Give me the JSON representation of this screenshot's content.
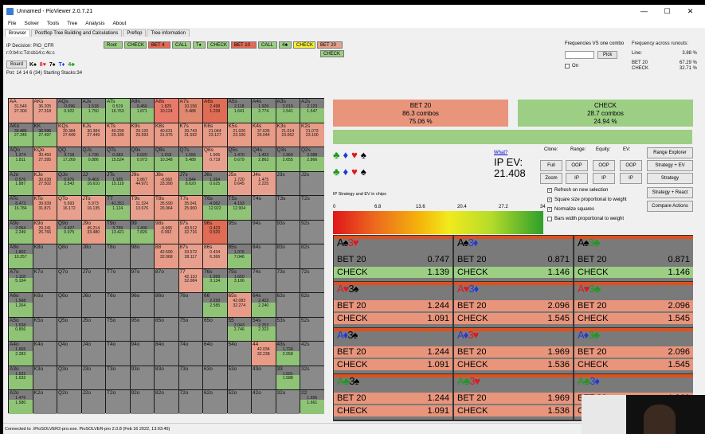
{
  "window": {
    "title": "Unnamed - PioViewer 2.0.7.21",
    "min": "—",
    "max": "☐",
    "close": "✕"
  },
  "menu": [
    "File",
    "Solver",
    "Tools",
    "Tree",
    "Analysis",
    "About"
  ],
  "tabs": [
    "Browser",
    "Postflop Tree Building and Calculations",
    "Preflop",
    "Tree information"
  ],
  "info": {
    "decision": "IP Decision:  PIO_CFR",
    "board_str": "r:0:b4:c:Td:cb14:c:4c:c",
    "board_btn": "Board",
    "pot": "Pot: 14 14 6 (34) Starting Stacks:34"
  },
  "board_cards": [
    {
      "r": "K",
      "s": "♠",
      "c": "sp"
    },
    {
      "r": "8",
      "s": "♥",
      "c": "ht"
    },
    {
      "r": "7",
      "s": "♠",
      "c": "sp"
    },
    {
      "r": "T",
      "s": "♦",
      "c": "dm"
    },
    {
      "r": "4",
      "s": "♣",
      "c": "cl"
    }
  ],
  "tree": [
    {
      "label": "Root",
      "bg": "#9ccf84",
      "row": 0
    },
    {
      "label": "CHECK",
      "bg": "#9ccf84",
      "row": 0
    },
    {
      "label": "BET 4",
      "bg": "#e26a55",
      "row": 0
    },
    {
      "label": "CALL",
      "bg": "#9ccf84",
      "row": 0
    },
    {
      "label": "T♦",
      "bg": "#9ccf84",
      "row": 0
    },
    {
      "label": "CHECK",
      "bg": "#9ccf84",
      "row": 0
    },
    {
      "label": "BET 10",
      "bg": "#e26a55",
      "row": 0
    },
    {
      "label": "CALL",
      "bg": "#9ccf84",
      "row": 0
    },
    {
      "label": "4♣",
      "bg": "#9ccf84",
      "row": 0
    },
    {
      "label": "CHECK",
      "bg": "#f7f03a",
      "row": 0
    },
    {
      "label": "BET 20",
      "bg": "#e6a08b",
      "row": 0
    },
    {
      "label": "CHECK",
      "bg": "#9ccf84",
      "row": 1
    }
  ],
  "freq": {
    "title": "Frequencies VS one combo",
    "pick": "Pick",
    "on": "On"
  },
  "runouts": {
    "title": "Frequency across runouts:",
    "line_label": "Line:",
    "line_val": "3.88 %",
    "rows": [
      {
        "k": "BET 20",
        "v": "67.29 %"
      },
      {
        "k": "CHECK",
        "v": "32.71 %"
      }
    ]
  },
  "matrix": {
    "names": [
      [
        "AA",
        "AKs",
        "AQs",
        "AJs",
        "ATs",
        "A9s",
        "A8s",
        "A7s",
        "A6s",
        "A5s",
        "A4s",
        "A3s",
        "A2s"
      ],
      [
        "AKo",
        "KK",
        "KQs",
        "KJs",
        "KTs",
        "K9s",
        "K8s",
        "K7s",
        "K6s",
        "K5s",
        "K4s",
        "K3s",
        "K2s"
      ],
      [
        "AQo",
        "KQo",
        "QQ",
        "QJs",
        "QTs",
        "Q9s",
        "Q8s",
        "Q7s",
        "Q6s",
        "Q5s",
        "Q4s",
        "Q3s",
        "Q2s"
      ],
      [
        "AJo",
        "KJo",
        "QJo",
        "JJ",
        "JTs",
        "J9s",
        "J8s",
        "J7s",
        "J6s",
        "J5s",
        "J4s",
        "J3s",
        "J2s"
      ],
      [
        "ATo",
        "KTo",
        "QTo",
        "JTo",
        "TT",
        "T9s",
        "T8s",
        "T7s",
        "T6s",
        "T5s",
        "T4s",
        "T3s",
        "T2s"
      ],
      [
        "A9o",
        "K9o",
        "Q9o",
        "J9o",
        "T9o",
        "99",
        "98s",
        "97s",
        "96s",
        "95s",
        "94s",
        "93s",
        "92s"
      ],
      [
        "A8o",
        "K8o",
        "Q8o",
        "J8o",
        "T8o",
        "98o",
        "88",
        "87s",
        "86s",
        "85s",
        "84s",
        "83s",
        "82s"
      ],
      [
        "A7o",
        "K7o",
        "Q7o",
        "J7o",
        "T7o",
        "97o",
        "87o",
        "77",
        "76s",
        "75s",
        "74s",
        "73s",
        "72s"
      ],
      [
        "A6o",
        "K6o",
        "Q6o",
        "J6o",
        "T6o",
        "96o",
        "86o",
        "76o",
        "66",
        "65s",
        "64s",
        "63s",
        "62s"
      ],
      [
        "A5o",
        "K5o",
        "Q5o",
        "J5o",
        "T5o",
        "95o",
        "85o",
        "75o",
        "65o",
        "55",
        "54s",
        "53s",
        "52s"
      ],
      [
        "A4o",
        "K4o",
        "Q4o",
        "J4o",
        "T4o",
        "94o",
        "84o",
        "74o",
        "64o",
        "54o",
        "44",
        "43s",
        "42s"
      ],
      [
        "A3o",
        "K3o",
        "Q3o",
        "J3o",
        "T3o",
        "93o",
        "83o",
        "73o",
        "63o",
        "53o",
        "43o",
        "33",
        "32s"
      ],
      [
        "A2o",
        "K2o",
        "Q2o",
        "J2o",
        "T2o",
        "92o",
        "82o",
        "72o",
        "62o",
        "52o",
        "42o",
        "32o",
        "22"
      ]
    ],
    "vals": {
      "0,0": [
        "31.549",
        "27.300"
      ],
      "0,1": [
        "36.205",
        "27.318"
      ],
      "0,2": [
        "-0.096",
        "0.922"
      ],
      "0,3": [
        "1.518",
        "1.750"
      ],
      "0,4": [
        "0.519",
        "16.763"
      ],
      "0,5": [
        "0.456",
        "1.871"
      ],
      "0,6": [
        "1.825",
        "10.124"
      ],
      "0,7": [
        "10.156",
        "5.488"
      ],
      "0,8": [
        "2.498",
        "1.239"
      ],
      "0,9": [
        "2.118",
        "1.641"
      ],
      "0,10": [
        "1.926",
        "2.774"
      ],
      "0,11": [
        "2.019",
        "1.541"
      ],
      "0,12": [
        "2.123",
        "1.547"
      ],
      "1,0": [
        "30.485",
        "27.345"
      ],
      "1,1": [
        "36.596",
        "27.497"
      ],
      "1,2": [
        "30.384",
        "27.449"
      ],
      "1,3": [
        "30.384",
        "27.449"
      ],
      "1,4": [
        "40.299",
        "29.180"
      ],
      "1,5": [
        "29.120",
        "26.593"
      ],
      "1,6": [
        "40.631",
        "31.976"
      ],
      "1,7": [
        "39.743",
        "31.592"
      ],
      "1,8": [
        "21.044",
        "23.127"
      ],
      "1,9": [
        "21.026",
        "23.100"
      ],
      "1,10": [
        "37.635",
        "26.044"
      ],
      "1,11": [
        "21.014",
        "23.062"
      ],
      "1,12": [
        "21.073",
        "23.100"
      ],
      "2,0": [
        "1.374",
        "1.811"
      ],
      "2,1": [
        "30.450",
        "27.395"
      ],
      "2,2": [
        "9.718",
        "17.269"
      ],
      "2,3": [
        "1.736",
        "0.886"
      ],
      "2,4": [
        "0.283",
        "15.524"
      ],
      "2,5": [
        "0.020",
        "0.973"
      ],
      "2,6": [
        "1.918",
        "10.348"
      ],
      "2,7": [
        "1.556",
        "5.488"
      ],
      "2,8": [
        "1.606",
        "0.719"
      ],
      "2,9": [
        "1.470",
        "0.679"
      ],
      "2,10": [
        "1.422",
        "2.863"
      ],
      "2,11": [
        "1.969",
        "2.655"
      ],
      "2,12": [
        "2.088",
        "2.866"
      ],
      "3,0": [
        "0.576",
        "1.887"
      ],
      "3,1": [
        "30.639",
        "27.502"
      ],
      "3,2": [
        "0.676",
        "2.543"
      ],
      "3,3": [
        "9.463",
        "16.610"
      ],
      "3,4": [
        "1.165",
        "15.119"
      ],
      "3,5": [
        "5.867",
        "44.971"
      ],
      "3,6": [
        "-0.060",
        "33.390"
      ],
      "3,7": [
        "1.844",
        "8.620"
      ],
      "3,8": [
        "1.264",
        "0.625"
      ],
      "3,9": [
        "1.720",
        "0.645"
      ],
      "3,10": [
        "1.475",
        "2.225"
      ],
      "4,0": [
        "8.473",
        "16.784"
      ],
      "4,1": [
        "39.939",
        "31.871"
      ],
      "4,2": [
        "5.693",
        "16.172"
      ],
      "4,3": [
        "5.973",
        "16.135"
      ],
      "4,4": [
        "41.351",
        "1.124"
      ],
      "4,5": [
        "11.324",
        "13.676"
      ],
      "4,6": [
        "35.590",
        "26.964"
      ],
      "4,7": [
        "35.041",
        "25.900"
      ],
      "4,8": [
        "4.062",
        "12.922"
      ],
      "4,9": [
        "4.193",
        "12.904"
      ],
      "5,0": [
        "2.054",
        "2.249"
      ],
      "5,1": [
        "29.241",
        "26.766"
      ],
      "5,2": [
        "0.427",
        "0.975"
      ],
      "5,3": [
        "45.214",
        "33.480"
      ],
      "5,4": [
        "3.799",
        "13.421"
      ],
      "5,5": [
        "1.400",
        "7.826"
      ],
      "5,6": [
        "-0.665",
        "0.092"
      ],
      "5,7": [
        "43.512",
        "32.716"
      ],
      "5,8": [
        "0.423",
        "0.520"
      ],
      "6,0": [
        "1.802",
        "10.257"
      ],
      "6,6": [
        "42.590",
        "32.068"
      ],
      "6,7": [
        "33.572",
        "28.117"
      ],
      "6,8": [
        "0.434",
        "6.366"
      ],
      "6,9": [
        "1.076",
        "7.046"
      ],
      "7,0": [
        "1.118",
        "5.104"
      ],
      "7,7": [
        "42.110",
        "32.084"
      ],
      "7,8": [
        "1.959",
        "3.134"
      ],
      "7,9": [
        "1.650",
        "3.106"
      ],
      "8,0": [
        "1.568",
        "1.264"
      ],
      "8,8": [
        "2.220",
        "2.585"
      ],
      "8,9": [
        "42.083",
        "32.274"
      ],
      "8,10": [
        "2.422",
        "2.240"
      ],
      "9,0": [
        "1.638",
        "0.856"
      ],
      "9,9": [
        "2.043",
        "2.746"
      ],
      "9,10": [
        "2.252",
        "2.323"
      ],
      "10,0": [
        "1.665",
        "2.283"
      ],
      "10,10": [
        "42.034",
        "32.238"
      ],
      "10,11": [
        "1.724",
        "2.058"
      ],
      "11,0": [
        "1.531",
        "1.632"
      ],
      "11,11": [
        "1.501",
        "1.588"
      ],
      "12,0": [
        "1.476",
        "1.580"
      ],
      "12,12": [
        "1.656",
        "1.661"
      ]
    },
    "colors": {
      "0,0": "#e8a08e",
      "0,1": "#e8a08e",
      "0,4": "#8fc477",
      "0,6": "#e87a6a",
      "0,7": "#e08870",
      "0,8": "#e06c55",
      "1,2": "#e89c88",
      "1,3": "#e8a08e",
      "1,4": "#e89c88",
      "1,5": "#e89c88",
      "1,6": "#e89c88",
      "1,7": "#e89c88",
      "1,8": "#e89c88",
      "1,9": "#e89c88",
      "1,10": "#e89c88",
      "1,11": "#e89c88",
      "1,12": "#e89c88",
      "2,1": "#e89c88",
      "2,8": "#e8a08e",
      "3,1": "#e89c88",
      "3,5": "#e89c88",
      "3,6": "#e89c88",
      "3,9": "#e8a08e",
      "3,10": "#e8a08e",
      "4,1": "#e89c88",
      "4,2": "#e8a08e",
      "4,3": "#e8a08e",
      "4,5": "#e8a08e",
      "4,6": "#e89c88",
      "4,7": "#e89c88",
      "5,1": "#e89c88",
      "5,3": "#e89c88",
      "5,6": "#e89c88",
      "5,7": "#e89c88",
      "5,8": "#e06c55",
      "6,6": "#e89c88",
      "6,7": "#e8a08e",
      "6,8": "#e8a08e",
      "7,7": "#e8a08e",
      "8,9": "#e89c88",
      "10,10": "#e89c88"
    }
  },
  "summary": [
    {
      "label": "BET 20",
      "combos": "86.3 combos",
      "pct": "75.06 %",
      "bg": "#e8957c"
    },
    {
      "label": "CHECK",
      "combos": "28.7 combos",
      "pct": "24.94 %",
      "bg": "#9ccf84"
    }
  ],
  "ipev": {
    "what": "What?",
    "label": "IP EV:",
    "value": "21.408"
  },
  "suit_rows": [
    [
      {
        "s": "♣",
        "c": "cl"
      },
      {
        "s": "♦",
        "c": "dm"
      },
      {
        "s": "♥",
        "c": "ht"
      },
      {
        "s": "♠",
        "c": "sp"
      }
    ],
    [
      {
        "s": "♣",
        "c": "cl"
      },
      {
        "s": "♦",
        "c": "dm"
      },
      {
        "s": "♥",
        "c": "ht"
      },
      {
        "s": "♠",
        "c": "sp"
      }
    ]
  ],
  "strat_label": "IP Strategy and EV in chips",
  "scale": [
    "0",
    "6.8",
    "13.6",
    "20.4",
    "27.2",
    "34"
  ],
  "controls": {
    "headers": [
      "Clone:",
      "Range:",
      "Equity:",
      "EV:"
    ],
    "full": "Full",
    "zoom": "Zoom",
    "oop": "OOP",
    "ip": "IP",
    "range_explorer": "Range Explorer",
    "strategy_ev": "Strategy + EV",
    "strategy": "Strategy",
    "strategy_react": "Strategy + React",
    "compare": "Compare Actions"
  },
  "options": [
    {
      "label": "Refresh on new selection",
      "on": true
    },
    {
      "label": "Square size proportional to weight",
      "on": true
    },
    {
      "label": "Normalize squares",
      "on": true
    },
    {
      "label": "Bars width proportional to weight",
      "on": false
    }
  ],
  "runout_cells": [
    {
      "cards": [
        {
          "t": "A♠",
          "c": "sp"
        },
        {
          "t": "3♥",
          "c": "ht"
        }
      ],
      "bet": "0.747",
      "check": "1.139"
    },
    {
      "cards": [
        {
          "t": "A♠",
          "c": "sp"
        },
        {
          "t": "3♦",
          "c": "dm"
        }
      ],
      "bet": "0.871",
      "check": "1.146"
    },
    {
      "cards": [
        {
          "t": "A♠",
          "c": "sp"
        },
        {
          "t": "3♣",
          "c": "cl"
        }
      ],
      "bet": "0.871",
      "check": "1.146"
    },
    {
      "cards": [
        {
          "t": "A♥",
          "c": "ht"
        },
        {
          "t": "3♠",
          "c": "sp"
        }
      ],
      "bet": "1.244",
      "check": "1.091"
    },
    {
      "cards": [
        {
          "t": "A♥",
          "c": "ht"
        },
        {
          "t": "3♦",
          "c": "dm"
        }
      ],
      "bet": "2.096",
      "check": "1.545"
    },
    {
      "cards": [
        {
          "t": "A♥",
          "c": "ht"
        },
        {
          "t": "3♣",
          "c": "cl"
        }
      ],
      "bet": "2.096",
      "check": "1.545"
    },
    {
      "cards": [
        {
          "t": "A♦",
          "c": "dm"
        },
        {
          "t": "3♠",
          "c": "sp"
        }
      ],
      "bet": "1.244",
      "check": "1.091"
    },
    {
      "cards": [
        {
          "t": "A♦",
          "c": "dm"
        },
        {
          "t": "3♥",
          "c": "ht"
        }
      ],
      "bet": "1.969",
      "check": "1.536"
    },
    {
      "cards": [
        {
          "t": "A♦",
          "c": "dm"
        },
        {
          "t": "3♣",
          "c": "cl"
        }
      ],
      "bet": "2.096",
      "check": "1.545"
    },
    {
      "cards": [
        {
          "t": "A♣",
          "c": "cl"
        },
        {
          "t": "3♠",
          "c": "sp"
        }
      ],
      "bet": "1.244",
      "check": "1.091"
    },
    {
      "cards": [
        {
          "t": "A♣",
          "c": "cl"
        },
        {
          "t": "3♥",
          "c": "ht"
        }
      ],
      "bet": "1.969",
      "check": "1.536"
    },
    {
      "cards": [
        {
          "t": "A♣",
          "c": "cl"
        },
        {
          "t": "3♦",
          "c": "dm"
        }
      ],
      "bet": "1.969",
      "check": "1.536"
    }
  ],
  "runout_labels": {
    "bet": "BET 20",
    "check": "CHECK"
  },
  "status": "Connected to .\\PioSOLVER2-pro.exe. PioSOLVER-pro 2.0.8 (Feb 16 2022, 13:03:45)"
}
